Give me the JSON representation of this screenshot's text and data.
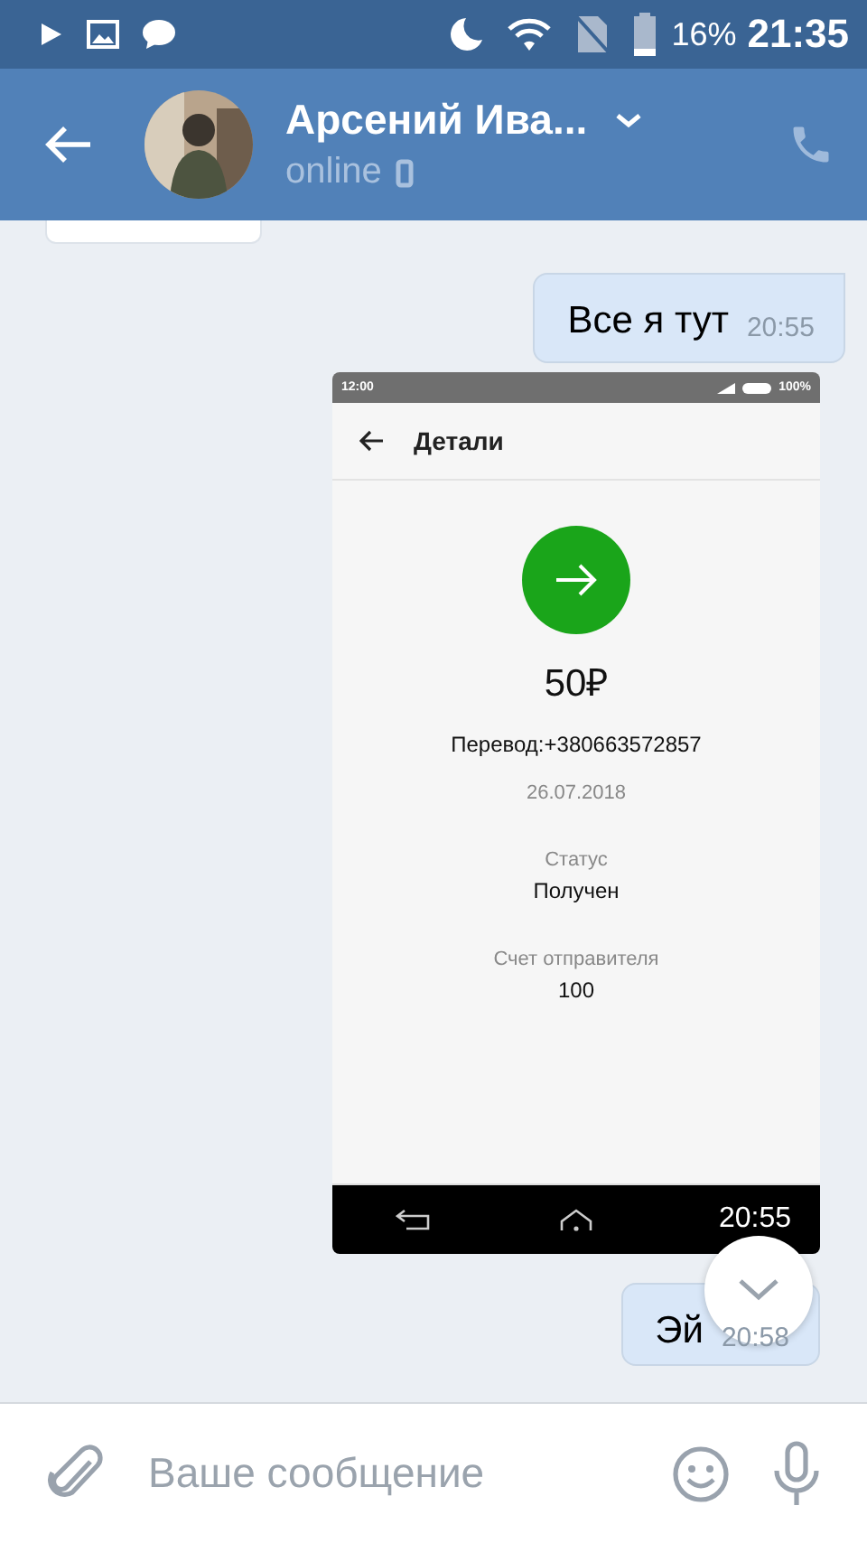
{
  "status_bar": {
    "battery": "16%",
    "time": "21:35"
  },
  "header": {
    "name": "Арсений Ива...",
    "presence": "online"
  },
  "messages": [
    {
      "kind": "partial"
    },
    {
      "kind": "text",
      "text": "Все я тут",
      "time": "20:55"
    },
    {
      "kind": "screenshot",
      "time": "20:55",
      "shot": {
        "status_time": "12:00",
        "status_battery": "100%",
        "title": "Детали",
        "amount": "50₽",
        "transfer": "Перевод:+380663572857",
        "date": "26.07.2018",
        "status_label": "Статус",
        "status_value": "Получен",
        "account_label": "Счет отправителя",
        "account_value": "100"
      }
    },
    {
      "kind": "text",
      "text": "Эй",
      "time": "20:58"
    }
  ],
  "composer": {
    "placeholder": "Ваше сообщение"
  }
}
